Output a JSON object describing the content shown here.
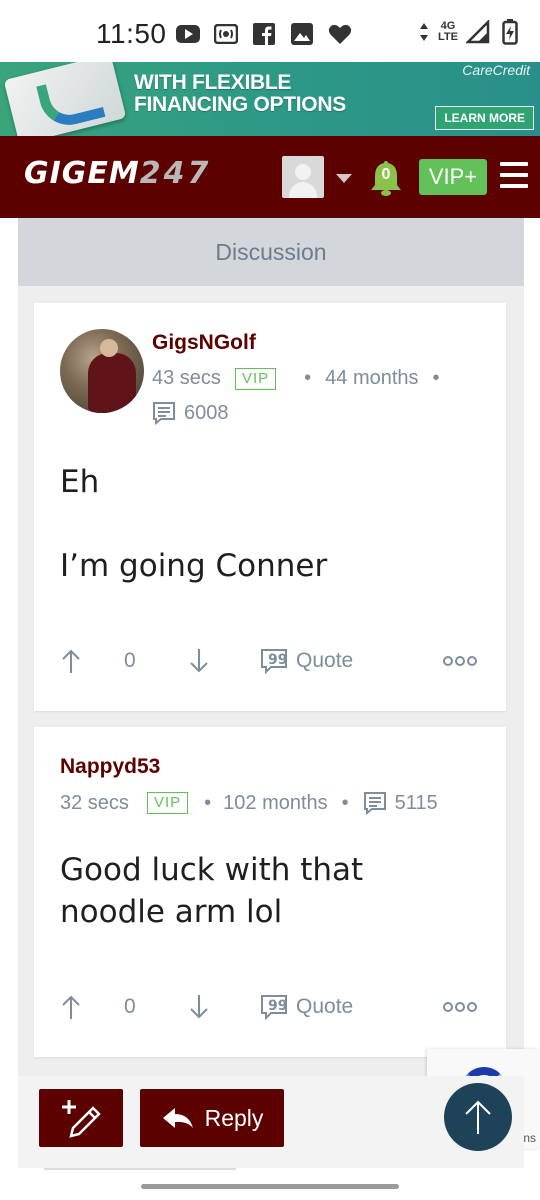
{
  "status_bar": {
    "time": "11:50",
    "left_icons": [
      "youtube-icon",
      "radio-icon",
      "facebook-icon",
      "gallery-icon",
      "heart-icon"
    ],
    "network": "4G LTE",
    "right_icons": [
      "data-arrows-icon",
      "signal-icon",
      "battery-icon"
    ]
  },
  "ad": {
    "headline_line1": "WITH FLEXIBLE",
    "headline_line2": "FINANCING OPTIONS",
    "brand": "CareCredit",
    "cta": "LEARN MORE",
    "colors": {
      "background": "#2e9a86",
      "cta_background": "#2fa472"
    }
  },
  "header": {
    "logo_text": "GIGEM",
    "logo_number": "247",
    "notification_count": "0",
    "vip_label": "VIP+",
    "colors": {
      "background": "#5c0000",
      "vip": "#63c15a",
      "bell": "#8bc34a"
    }
  },
  "discussion": {
    "title": "Discussion"
  },
  "posts": [
    {
      "username": "GigsNGolf",
      "time_ago": "43 secs",
      "badge": "VIP",
      "membership": "44 months",
      "post_count": "6008",
      "body_line1": "Eh",
      "body_line2": "I’m going Conner",
      "votes": "0",
      "quote_label": "Quote"
    },
    {
      "username": "Nappyd53",
      "time_ago": "32 secs",
      "badge": "VIP",
      "membership": "102 months",
      "post_count": "5115",
      "body_line1": "Good luck with that",
      "body_line2": "noodle arm lol",
      "votes": "0",
      "quote_label": "Quote"
    }
  ],
  "bottom": {
    "reply_label": "Reply",
    "recaptcha_text": "ns"
  }
}
